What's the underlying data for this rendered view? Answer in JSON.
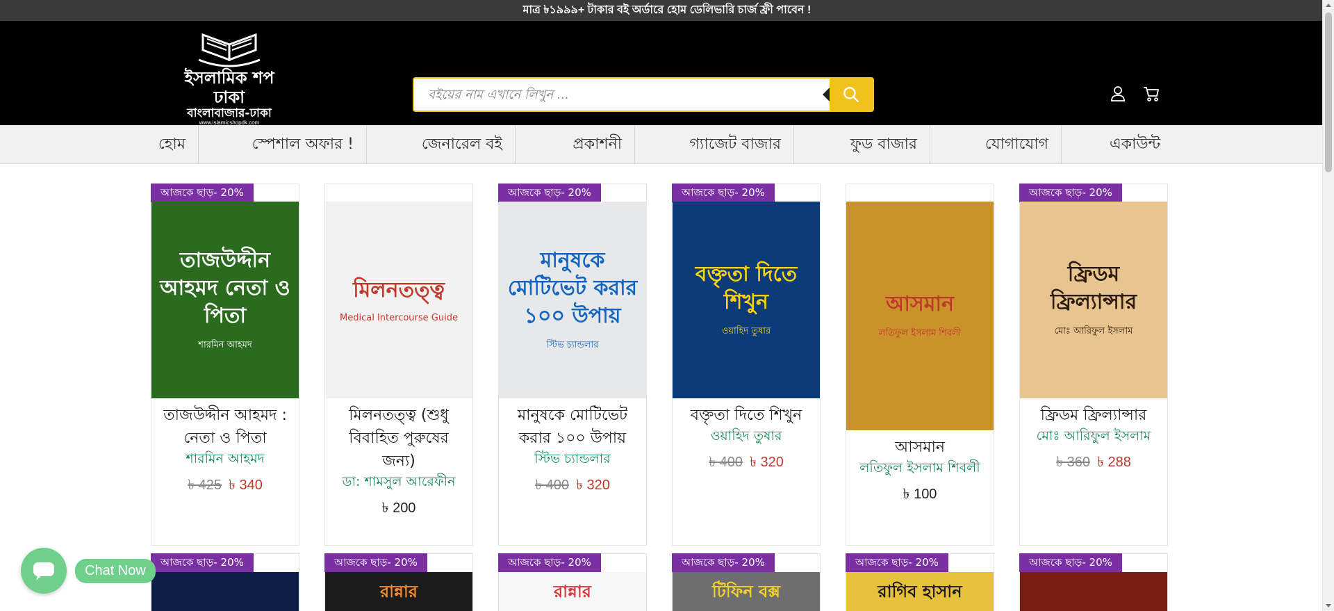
{
  "topbar": {
    "text": "মাত্র ৳১৯৯৯+ টাকার বই অর্ডারে হোম ডেলিভারি চার্জ ফ্রী পাবেন !"
  },
  "logo": {
    "line1": "ইসলামিক শপ ঢাকা",
    "line2": "বাংলাবাজার-ঢাকা",
    "url": "www.islamicshopdk.com"
  },
  "search": {
    "placeholder": "বইয়ের নাম এখানে লিখুন ..."
  },
  "nav": [
    "হোম",
    "স্পেশাল অফার !",
    "জেনারেল বই",
    "প্রকাশনী",
    "গ্যাজেট বাজার",
    "ফুড বাজার",
    "যোগাযোগ",
    "একাউন্ট"
  ],
  "products": [
    {
      "badge": "আজকে ছাড়- 20%",
      "cover_title": "তাজউদ্দীন আহমদ নেতা ও পিতা",
      "cover_sub": "শারমিন আহমদ",
      "title": "তাজউদ্দীন আহমদ : নেতা ও পিতা",
      "author": "শারমিন আহমদ",
      "old_price": "৳ 425",
      "price": "৳ 340",
      "bg": "#2a6b1f",
      "fg": "#ffffff"
    },
    {
      "badge": "",
      "cover_title": "মিলনতত্ত্ব",
      "cover_sub": "Medical Intercourse Guide",
      "title": "মিলনতত্ত্ব (শুধু বিবাহিত পুরুষের জন্য)",
      "author": "ডা: শামসুল আরেফীন",
      "old_price": "",
      "price": "৳ 200",
      "bg": "#f2f2f2",
      "fg": "#c0392b"
    },
    {
      "badge": "আজকে ছাড়- 20%",
      "cover_title": "মানুষকে মোটিভেট করার ১০০ উপায়",
      "cover_sub": "স্টিভ চ্যান্ডলার",
      "title": "মানুষকে মোটিভেট করার ১০০ উপায়",
      "author": "স্টিভ চ্যান্ডলার",
      "old_price": "৳ 400",
      "price": "৳ 320",
      "bg": "#e6e8ea",
      "fg": "#1565c0"
    },
    {
      "badge": "আজকে ছাড়- 20%",
      "cover_title": "বক্তৃতা দিতে শিখুন",
      "cover_sub": "ওয়াহিদ তুষার",
      "title": "বক্তৃতা দিতে শিখুন",
      "author": "ওয়াহিদ তুষার",
      "old_price": "৳ 400",
      "price": "৳ 320",
      "bg": "#0d3b7a",
      "fg": "#f7d20f"
    },
    {
      "badge": "",
      "cover_title": "আসমান",
      "cover_sub": "লতিফুল ইসলাম শিবলী",
      "title": "আসমান",
      "author": "লতিফুল ইসলাম শিবলী",
      "old_price": "",
      "price": "৳ 100",
      "bg": "#c9922a",
      "fg": "#c0392b"
    },
    {
      "badge": "আজকে ছাড়- 20%",
      "cover_title": "ফ্রিডম ফ্রিল্যান্সার",
      "cover_sub": "মোঃ আরিফুল ইসলাম",
      "title": "ফ্রিডম ফ্রিল্যান্সার",
      "author": "মোঃ আরিফুল ইসলাম",
      "old_price": "৳ 360",
      "price": "৳ 288",
      "bg": "#e8c48e",
      "fg": "#2b1a10"
    }
  ],
  "row2": [
    {
      "badge": "আজকে ছাড়- 20%",
      "text": "",
      "bg": "#0e1f4a",
      "fg": "#ffffff"
    },
    {
      "badge": "আজকে ছাড়- 20%",
      "text": "রান্নার",
      "bg": "#1b1b1b",
      "fg": "#f28b2c"
    },
    {
      "badge": "আজকে ছাড়- 20%",
      "text": "রান্নার",
      "bg": "#f6f6f6",
      "fg": "#d6393f"
    },
    {
      "badge": "আজকে ছাড়- 20%",
      "text": "টিফিন বক্স",
      "bg": "#6e6e6e",
      "fg": "#f5d22a"
    },
    {
      "badge": "আজকে ছাড়- 20%",
      "text": "রাগিব হাসান",
      "bg": "#e7c13b",
      "fg": "#1c1c1c"
    },
    {
      "badge": "আজকে ছাড়- 20%",
      "text": "",
      "bg": "#7a1d12",
      "fg": "#f5c518"
    }
  ],
  "chat": {
    "label": "Chat Now"
  },
  "colors": {
    "accent": "#f2c21c",
    "badge": "#7a2fa3",
    "author": "#1a8a5a",
    "sale": "#c0392b"
  }
}
